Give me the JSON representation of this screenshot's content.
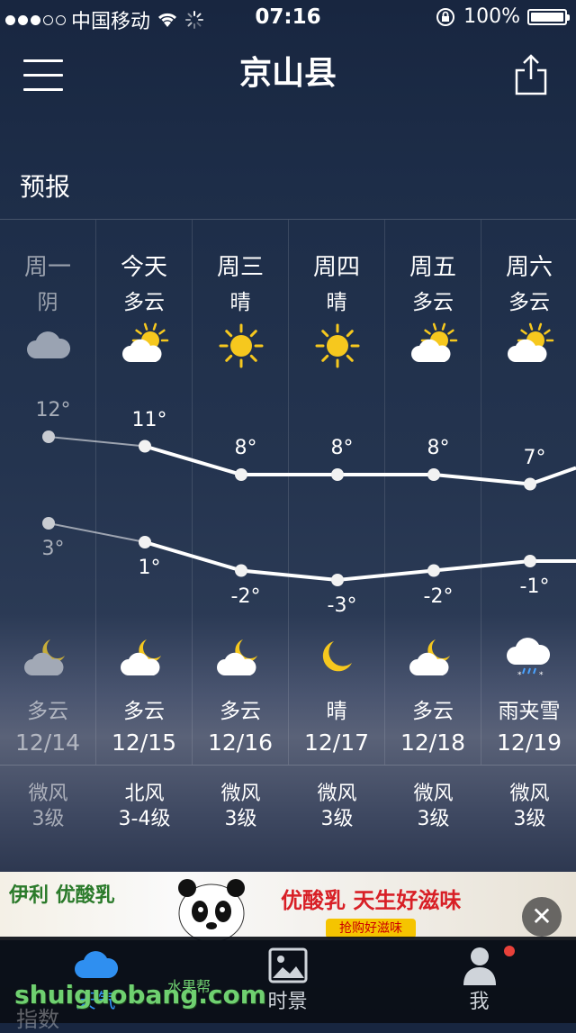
{
  "status": {
    "carrier": "中国移动",
    "time": "07:16",
    "battery": "100%",
    "signal_bars": 3,
    "battery_level": 1.0
  },
  "header": {
    "title": "京山县",
    "menu_icon": "menu-icon",
    "share_icon": "share-icon"
  },
  "section_title": "预报",
  "days": [
    {
      "day": "周一",
      "cond_day": "阴",
      "icon_day": "cloudy-icon",
      "high": "12°",
      "low": "3°",
      "icon_night": "partly-cloudy-night-icon",
      "cond_night": "多云",
      "date": "12/14",
      "wind_dir": "微风",
      "wind_lvl": "3级",
      "past": true
    },
    {
      "day": "今天",
      "cond_day": "多云",
      "icon_day": "partly-cloudy-day-icon",
      "high": "11°",
      "low": "1°",
      "icon_night": "partly-cloudy-night-icon",
      "cond_night": "多云",
      "date": "12/15",
      "wind_dir": "北风",
      "wind_lvl": "3-4级",
      "past": false
    },
    {
      "day": "周三",
      "cond_day": "晴",
      "icon_day": "sun-icon",
      "high": "8°",
      "low": "-2°",
      "icon_night": "partly-cloudy-night-icon",
      "cond_night": "多云",
      "date": "12/16",
      "wind_dir": "微风",
      "wind_lvl": "3级",
      "past": false
    },
    {
      "day": "周四",
      "cond_day": "晴",
      "icon_day": "sun-icon",
      "high": "8°",
      "low": "-3°",
      "icon_night": "moon-icon",
      "cond_night": "晴",
      "date": "12/17",
      "wind_dir": "微风",
      "wind_lvl": "3级",
      "past": false
    },
    {
      "day": "周五",
      "cond_day": "多云",
      "icon_day": "partly-cloudy-day-icon",
      "high": "8°",
      "low": "-2°",
      "icon_night": "partly-cloudy-night-icon",
      "cond_night": "多云",
      "date": "12/18",
      "wind_dir": "微风",
      "wind_lvl": "3级",
      "past": false
    },
    {
      "day": "周六",
      "cond_day": "多云",
      "icon_day": "partly-cloudy-day-icon",
      "high": "7°",
      "low": "-1°",
      "icon_night": "sleet-icon",
      "cond_night": "雨夹雪",
      "date": "12/19",
      "wind_dir": "微风",
      "wind_lvl": "3级",
      "past": false
    }
  ],
  "chart_data": {
    "type": "line",
    "categories": [
      "12/14",
      "12/15",
      "12/16",
      "12/17",
      "12/18",
      "12/19"
    ],
    "series": [
      {
        "values": [
          12,
          11,
          8,
          8,
          8,
          7
        ]
      },
      {
        "values": [
          3,
          1,
          -2,
          -3,
          -2,
          -1
        ]
      }
    ]
  },
  "ad": {
    "brand": "伊利 优酸乳",
    "slogan": "优酸乳 天生好滋味",
    "button": "抢购好滋味",
    "close": "✕"
  },
  "tabs": [
    {
      "label": "天气",
      "icon": "cloud-icon",
      "active": true
    },
    {
      "label": "时景",
      "icon": "photo-icon",
      "active": false
    },
    {
      "label": "我",
      "icon": "user-icon",
      "active": false
    }
  ],
  "watermark": "shuiguobang.com",
  "watermark_sub": "水果帮",
  "tab_extra": "指数",
  "colors": {
    "accent": "#2f8ff0",
    "sun": "#f6c81e",
    "badge": "#e8413a"
  }
}
